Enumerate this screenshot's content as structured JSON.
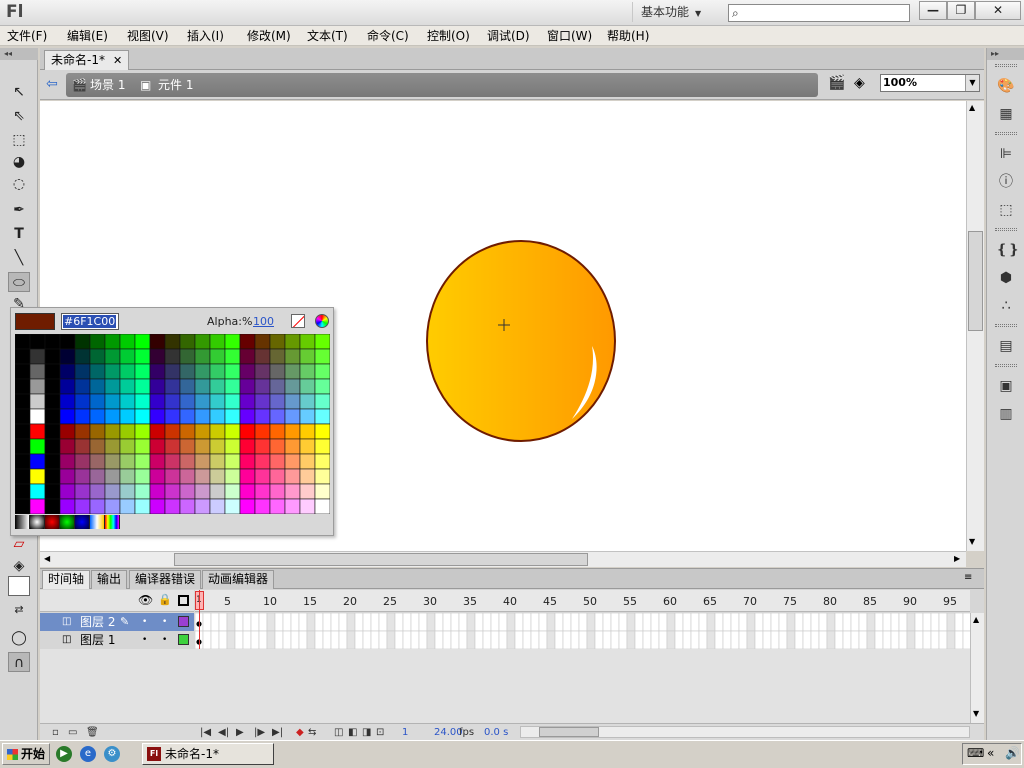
{
  "app": {
    "logo": "Fl",
    "workspace": "基本功能",
    "window_buttons": [
      "—",
      "❐",
      "✕"
    ]
  },
  "menu": [
    "文件(F)",
    "编辑(E)",
    "视图(V)",
    "插入(I)",
    "修改(M)",
    "文本(T)",
    "命令(C)",
    "控制(O)",
    "调试(D)",
    "窗口(W)",
    "帮助(H)"
  ],
  "document": {
    "tab": "未命名-1*",
    "close": "✕",
    "breadcrumb": {
      "scene": "场景 1",
      "symbol": "元件 1"
    },
    "zoom": "100%"
  },
  "swatch_panel": {
    "hex_value": "#6F1C00",
    "alpha_label": "Alpha:%",
    "alpha_value": "100",
    "current_color": "#6F1C00"
  },
  "timeline": {
    "tabs": [
      "时间轴",
      "输出",
      "编译器错误",
      "动画编辑器"
    ],
    "layers": [
      {
        "name": "图层 2",
        "selected": true,
        "color": "#9b3fd1"
      },
      {
        "name": "图层 1",
        "selected": false,
        "color": "#3ed13e"
      }
    ],
    "frame_numbers": [
      "1",
      "5",
      "10",
      "15",
      "20",
      "25",
      "30",
      "35",
      "40",
      "45",
      "50",
      "55",
      "60",
      "65",
      "70",
      "75",
      "80",
      "85",
      "90",
      "95"
    ],
    "current_frame": "1",
    "fps": "24.00",
    "fps_label": "fps",
    "time": "0.0 s"
  },
  "taskbar": {
    "start": "开始",
    "task": "未命名-1*"
  },
  "colors": {
    "accent": "#6e8dc7",
    "ball_light": "#ffcc00",
    "ball_dark": "#ff9900",
    "ball_stroke": "#6F1C00"
  }
}
